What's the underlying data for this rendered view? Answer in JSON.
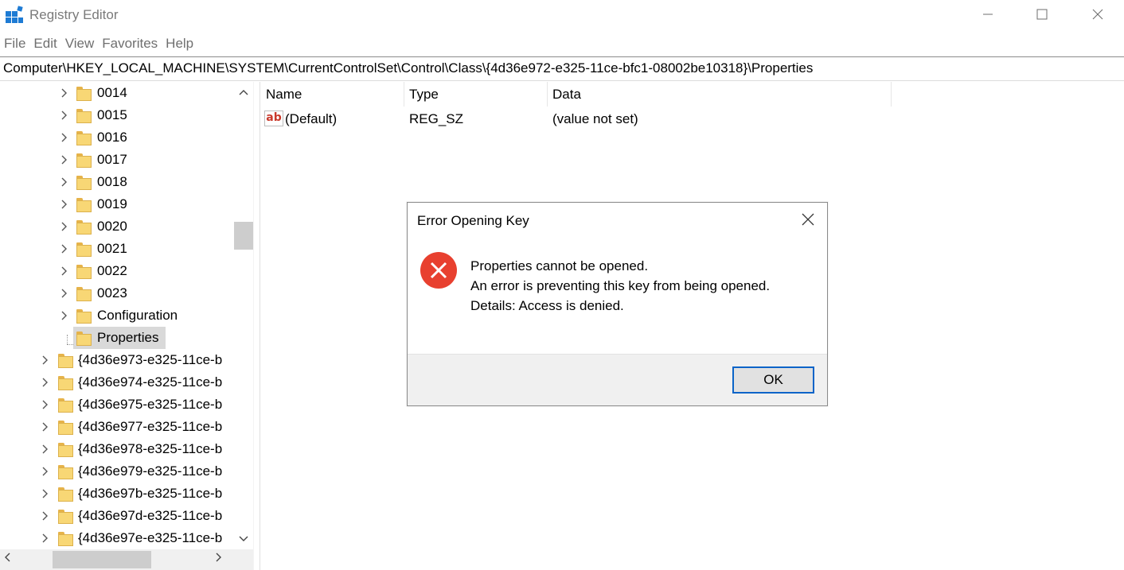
{
  "window": {
    "title": "Registry Editor",
    "minimize_glyph": "—",
    "maximize_glyph": "☐",
    "close_glyph": "✕"
  },
  "menu": {
    "items": [
      "File",
      "Edit",
      "View",
      "Favorites",
      "Help"
    ]
  },
  "address": {
    "path": "Computer\\HKEY_LOCAL_MACHINE\\SYSTEM\\CurrentControlSet\\Control\\Class\\{4d36e972-e325-11ce-bfc1-08002be10318}\\Properties"
  },
  "tree": {
    "children": [
      {
        "label": "0014",
        "expandable": true
      },
      {
        "label": "0015",
        "expandable": true
      },
      {
        "label": "0016",
        "expandable": true
      },
      {
        "label": "0017",
        "expandable": true
      },
      {
        "label": "0018",
        "expandable": true
      },
      {
        "label": "0019",
        "expandable": true
      },
      {
        "label": "0020",
        "expandable": true
      },
      {
        "label": "0021",
        "expandable": true
      },
      {
        "label": "0022",
        "expandable": true
      },
      {
        "label": "0023",
        "expandable": true
      },
      {
        "label": "Configuration",
        "expandable": true
      },
      {
        "label": "Properties",
        "expandable": false,
        "selected": true
      }
    ],
    "siblings": [
      {
        "label": "{4d36e973-e325-11ce-b",
        "expandable": true
      },
      {
        "label": "{4d36e974-e325-11ce-b",
        "expandable": true
      },
      {
        "label": "{4d36e975-e325-11ce-b",
        "expandable": true
      },
      {
        "label": "{4d36e977-e325-11ce-b",
        "expandable": true
      },
      {
        "label": "{4d36e978-e325-11ce-b",
        "expandable": true
      },
      {
        "label": "{4d36e979-e325-11ce-b",
        "expandable": true
      },
      {
        "label": "{4d36e97b-e325-11ce-b",
        "expandable": true
      },
      {
        "label": "{4d36e97d-e325-11ce-b",
        "expandable": true
      },
      {
        "label": "{4d36e97e-e325-11ce-b",
        "expandable": true
      }
    ]
  },
  "list": {
    "columns": {
      "name": "Name",
      "type": "Type",
      "data": "Data"
    },
    "rows": [
      {
        "icon": "string-value-icon",
        "icon_text": "ab",
        "name": "(Default)",
        "type": "REG_SZ",
        "data": "(value not set)"
      }
    ]
  },
  "dialog": {
    "title": "Error Opening Key",
    "close_glyph": "✕",
    "icon": "error-icon",
    "lines": [
      "Properties cannot be opened.",
      "An error is preventing this key from being opened.",
      "Details: Access is denied."
    ],
    "ok_label": "OK"
  },
  "scroll": {
    "up_glyph": "︿",
    "down_glyph": "﹀",
    "left_glyph": "<",
    "right_glyph": ">"
  },
  "colors": {
    "error_red": "#e8402f",
    "ok_border": "#0a64c8",
    "folder_yellow": "#f8d775",
    "selection_gray": "#d9d9d9",
    "registry_icon_blue": "#1e7bd4"
  }
}
